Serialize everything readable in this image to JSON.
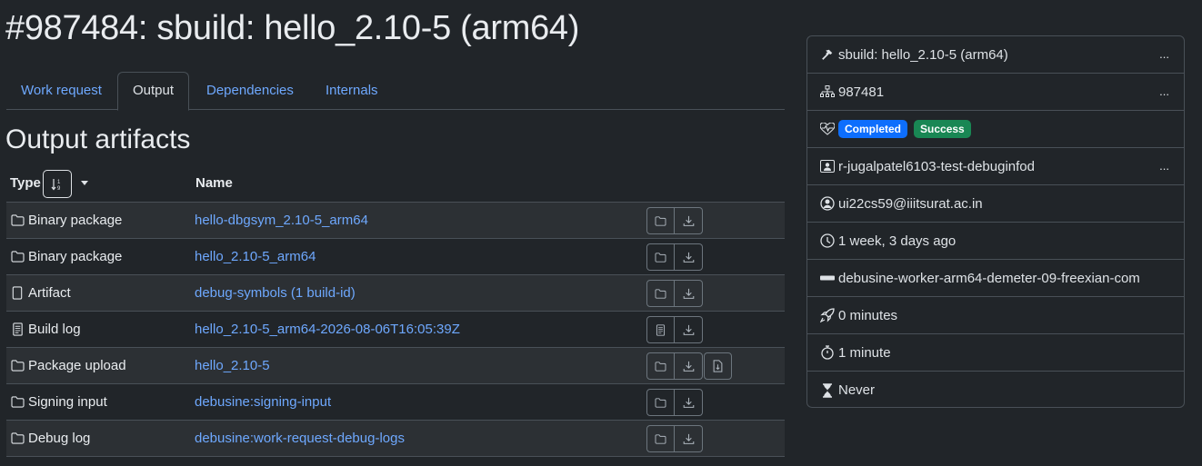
{
  "title": "#987484: sbuild: hello_2.10-5 (arm64)",
  "tabs": [
    {
      "label": "Work request",
      "active": false
    },
    {
      "label": "Output",
      "active": true
    },
    {
      "label": "Dependencies",
      "active": false
    },
    {
      "label": "Internals",
      "active": false
    }
  ],
  "section_title": "Output artifacts",
  "table": {
    "headers": {
      "type": "Type",
      "name": "Name"
    },
    "rows": [
      {
        "type": "Binary package",
        "type_icon": "folder-icon",
        "name": "hello-dbgsym_2.10-5_arm64",
        "actions": [
          "folder-icon",
          "download-icon"
        ]
      },
      {
        "type": "Binary package",
        "type_icon": "folder-icon",
        "name": "hello_2.10-5_arm64",
        "actions": [
          "folder-icon",
          "download-icon"
        ]
      },
      {
        "type": "Artifact",
        "type_icon": "file-icon",
        "name": "debug-symbols (1 build-id)",
        "actions": [
          "folder-icon",
          "download-icon"
        ]
      },
      {
        "type": "Build log",
        "type_icon": "log-icon",
        "name": "hello_2.10-5_arm64-2026-08-06T16:05:39Z",
        "actions": [
          "log-icon",
          "download-icon"
        ]
      },
      {
        "type": "Package upload",
        "type_icon": "folder-icon",
        "name": "hello_2.10-5",
        "actions": [
          "folder-icon",
          "download-icon",
          "file-download-icon"
        ]
      },
      {
        "type": "Signing input",
        "type_icon": "folder-icon",
        "name": "debusine:signing-input",
        "actions": [
          "folder-icon",
          "download-icon"
        ]
      },
      {
        "type": "Debug log",
        "type_icon": "folder-icon",
        "name": "debusine:work-request-debug-logs",
        "actions": [
          "folder-icon",
          "download-icon"
        ]
      }
    ]
  },
  "sidebar": {
    "task": "sbuild: hello_2.10-5 (arm64)",
    "workflow_id": "987481",
    "status_badges": [
      {
        "label": "Completed",
        "color": "#0d6efd"
      },
      {
        "label": "Success",
        "color": "#198754"
      }
    ],
    "workspace": "r-jugalpatel6103-test-debuginfod",
    "user": "ui22cs59@iiitsurat.ac.in",
    "created": "1 week, 3 days ago",
    "worker": "debusine-worker-arm64-demeter-09-freexian-com",
    "started": "0 minutes",
    "duration": "1 minute",
    "expiration": "Never",
    "more_label": "..."
  }
}
